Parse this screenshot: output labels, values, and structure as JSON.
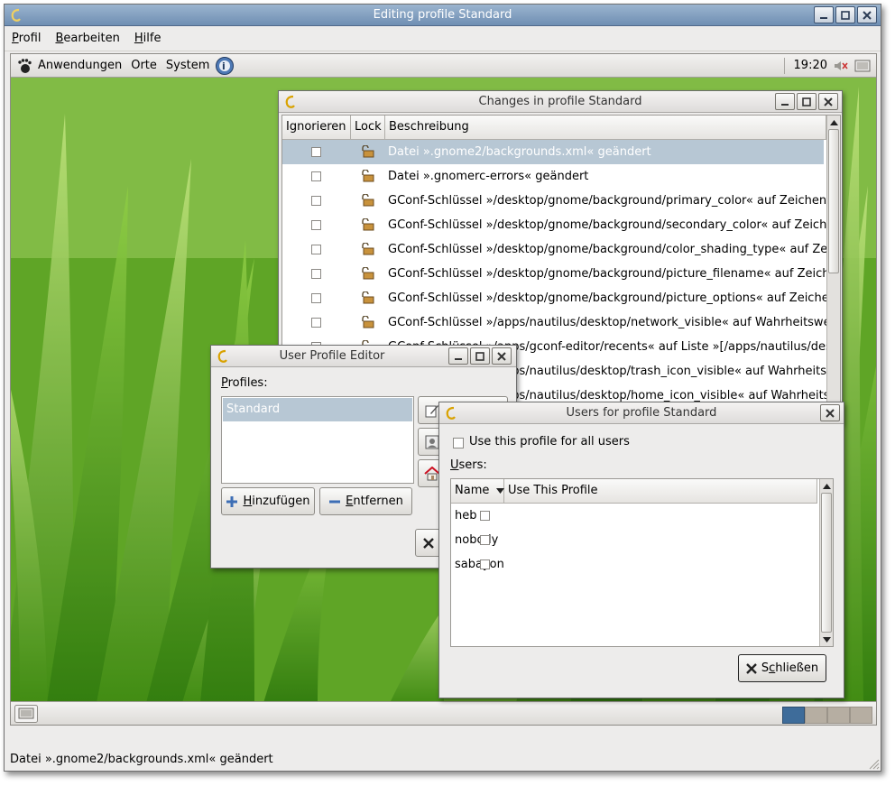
{
  "main_window": {
    "title": "Editing profile Standard",
    "menu": [
      {
        "label": "Profil",
        "mnemonic": "P",
        "rest": "rofil"
      },
      {
        "label": "Bearbeiten",
        "mnemonic": "B",
        "rest": "earbeiten"
      },
      {
        "label": "Hilfe",
        "mnemonic": "H",
        "rest": "ilfe"
      }
    ]
  },
  "gnome_panel": {
    "menus": [
      "Anwendungen",
      "Orte",
      "System"
    ],
    "clock": "19:20"
  },
  "changes_window": {
    "title": "Changes in profile Standard",
    "columns": [
      "Ignorieren",
      "Lock",
      "Beschreibung"
    ],
    "rows": [
      {
        "description": "Datei ».gnome2/backgrounds.xml« geändert",
        "selected": true
      },
      {
        "description": "Datei ».gnomerc-errors« geändert",
        "selected": false
      },
      {
        "description": "GConf-Schlüssel »/desktop/gnome/background/primary_color« auf Zeichenket",
        "selected": false
      },
      {
        "description": "GConf-Schlüssel »/desktop/gnome/background/secondary_color« auf Zeichenk",
        "selected": false
      },
      {
        "description": "GConf-Schlüssel »/desktop/gnome/background/color_shading_type« auf Zeich",
        "selected": false
      },
      {
        "description": "GConf-Schlüssel »/desktop/gnome/background/picture_filename« auf Zeichen",
        "selected": false
      },
      {
        "description": "GConf-Schlüssel »/desktop/gnome/background/picture_options« auf Zeichenke",
        "selected": false
      },
      {
        "description": "GConf-Schlüssel »/apps/nautilus/desktop/network_visible« auf Wahrheitswert",
        "selected": false
      },
      {
        "description": "GConf-Schlüssel »/apps/gconf-editor/recents« auf Liste »[/apps/nautilus/desk",
        "selected": false
      },
      {
        "description": "GConf-Schlüssel »/apps/nautilus/desktop/trash_icon_visible« auf Wahrheitswe",
        "selected": false
      },
      {
        "description": "GConf-Schlüssel »/apps/nautilus/desktop/home_icon_visible« auf Wahrheitswe",
        "selected": false
      }
    ]
  },
  "profile_editor": {
    "title": "User Profile Editor",
    "profiles_label": "Profiles:",
    "profiles": [
      "Standard"
    ],
    "add_button": "Hinzufügen",
    "remove_button": "Entfernen"
  },
  "users_window": {
    "title": "Users for profile Standard",
    "all_users_label": "Use this profile for all users",
    "users_label": "Users:",
    "columns": [
      "Name",
      "Use This Profile"
    ],
    "users": [
      "heb",
      "nobody",
      "sabayon"
    ],
    "close_button": "Schließen"
  },
  "statusbar": {
    "text": "Datei ».gnome2/backgrounds.xml« geändert"
  },
  "colors": {
    "titlebar_active": "#7e9cbd",
    "selection": "#b7c7d4",
    "workspace_active": "#3a6ea5"
  }
}
